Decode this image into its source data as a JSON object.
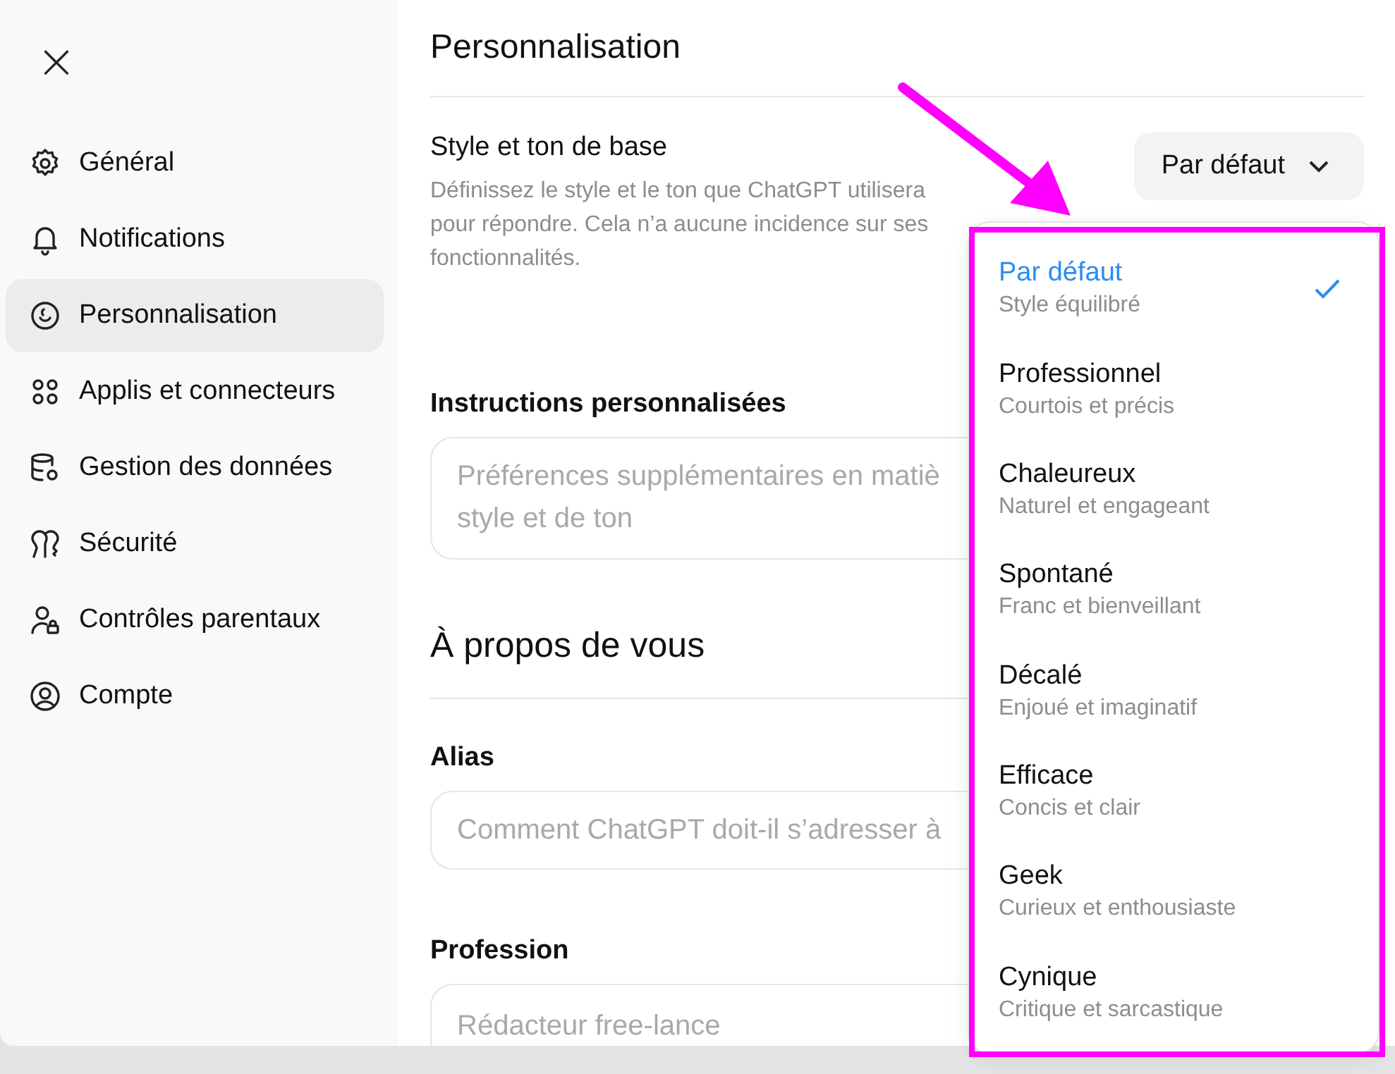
{
  "sidebar": {
    "close": "×",
    "items": [
      {
        "label": "Général",
        "selected": false
      },
      {
        "label": "Notifications",
        "selected": false
      },
      {
        "label": "Personnalisation",
        "selected": true
      },
      {
        "label": "Applis et connecteurs",
        "selected": false
      },
      {
        "label": "Gestion des données",
        "selected": false
      },
      {
        "label": "Sécurité",
        "selected": false
      },
      {
        "label": "Contrôles parentaux",
        "selected": false
      },
      {
        "label": "Compte",
        "selected": false
      }
    ]
  },
  "main": {
    "title": "Personnalisation",
    "style": {
      "label": "Style et ton de base",
      "description": "Définissez le style et le ton que ChatGPT utilisera pour répondre. Cela n’a aucune incidence sur ses fonctionnalités.",
      "value": "Par défaut",
      "expanded": true
    },
    "instructions": {
      "label": "Instructions personnalisées",
      "placeholder_lines": [
        "Préférences supplémentaires en matiè",
        "style et de ton"
      ]
    },
    "about_title": "À propos de vous",
    "alias": {
      "label": "Alias",
      "placeholder": "Comment ChatGPT doit-il s’adresser à"
    },
    "profession": {
      "label": "Profession",
      "placeholder": "Rédacteur free-lance"
    }
  },
  "dropdown": {
    "options": [
      {
        "label": "Par défaut",
        "sub": "Style équilibré",
        "selected": true
      },
      {
        "label": "Professionnel",
        "sub": "Courtois et précis",
        "selected": false
      },
      {
        "label": "Chaleureux",
        "sub": "Naturel et engageant",
        "selected": false
      },
      {
        "label": "Spontané",
        "sub": "Franc et bienveillant",
        "selected": false
      },
      {
        "label": "Décalé",
        "sub": "Enjoué et imaginatif",
        "selected": false
      },
      {
        "label": "Efficace",
        "sub": "Concis et clair",
        "selected": false
      },
      {
        "label": "Geek",
        "sub": "Curieux et enthousiaste",
        "selected": false
      },
      {
        "label": "Cynique",
        "sub": "Critique et sarcastique",
        "selected": false
      }
    ]
  },
  "annotation": {
    "kind": "arrow-box"
  }
}
